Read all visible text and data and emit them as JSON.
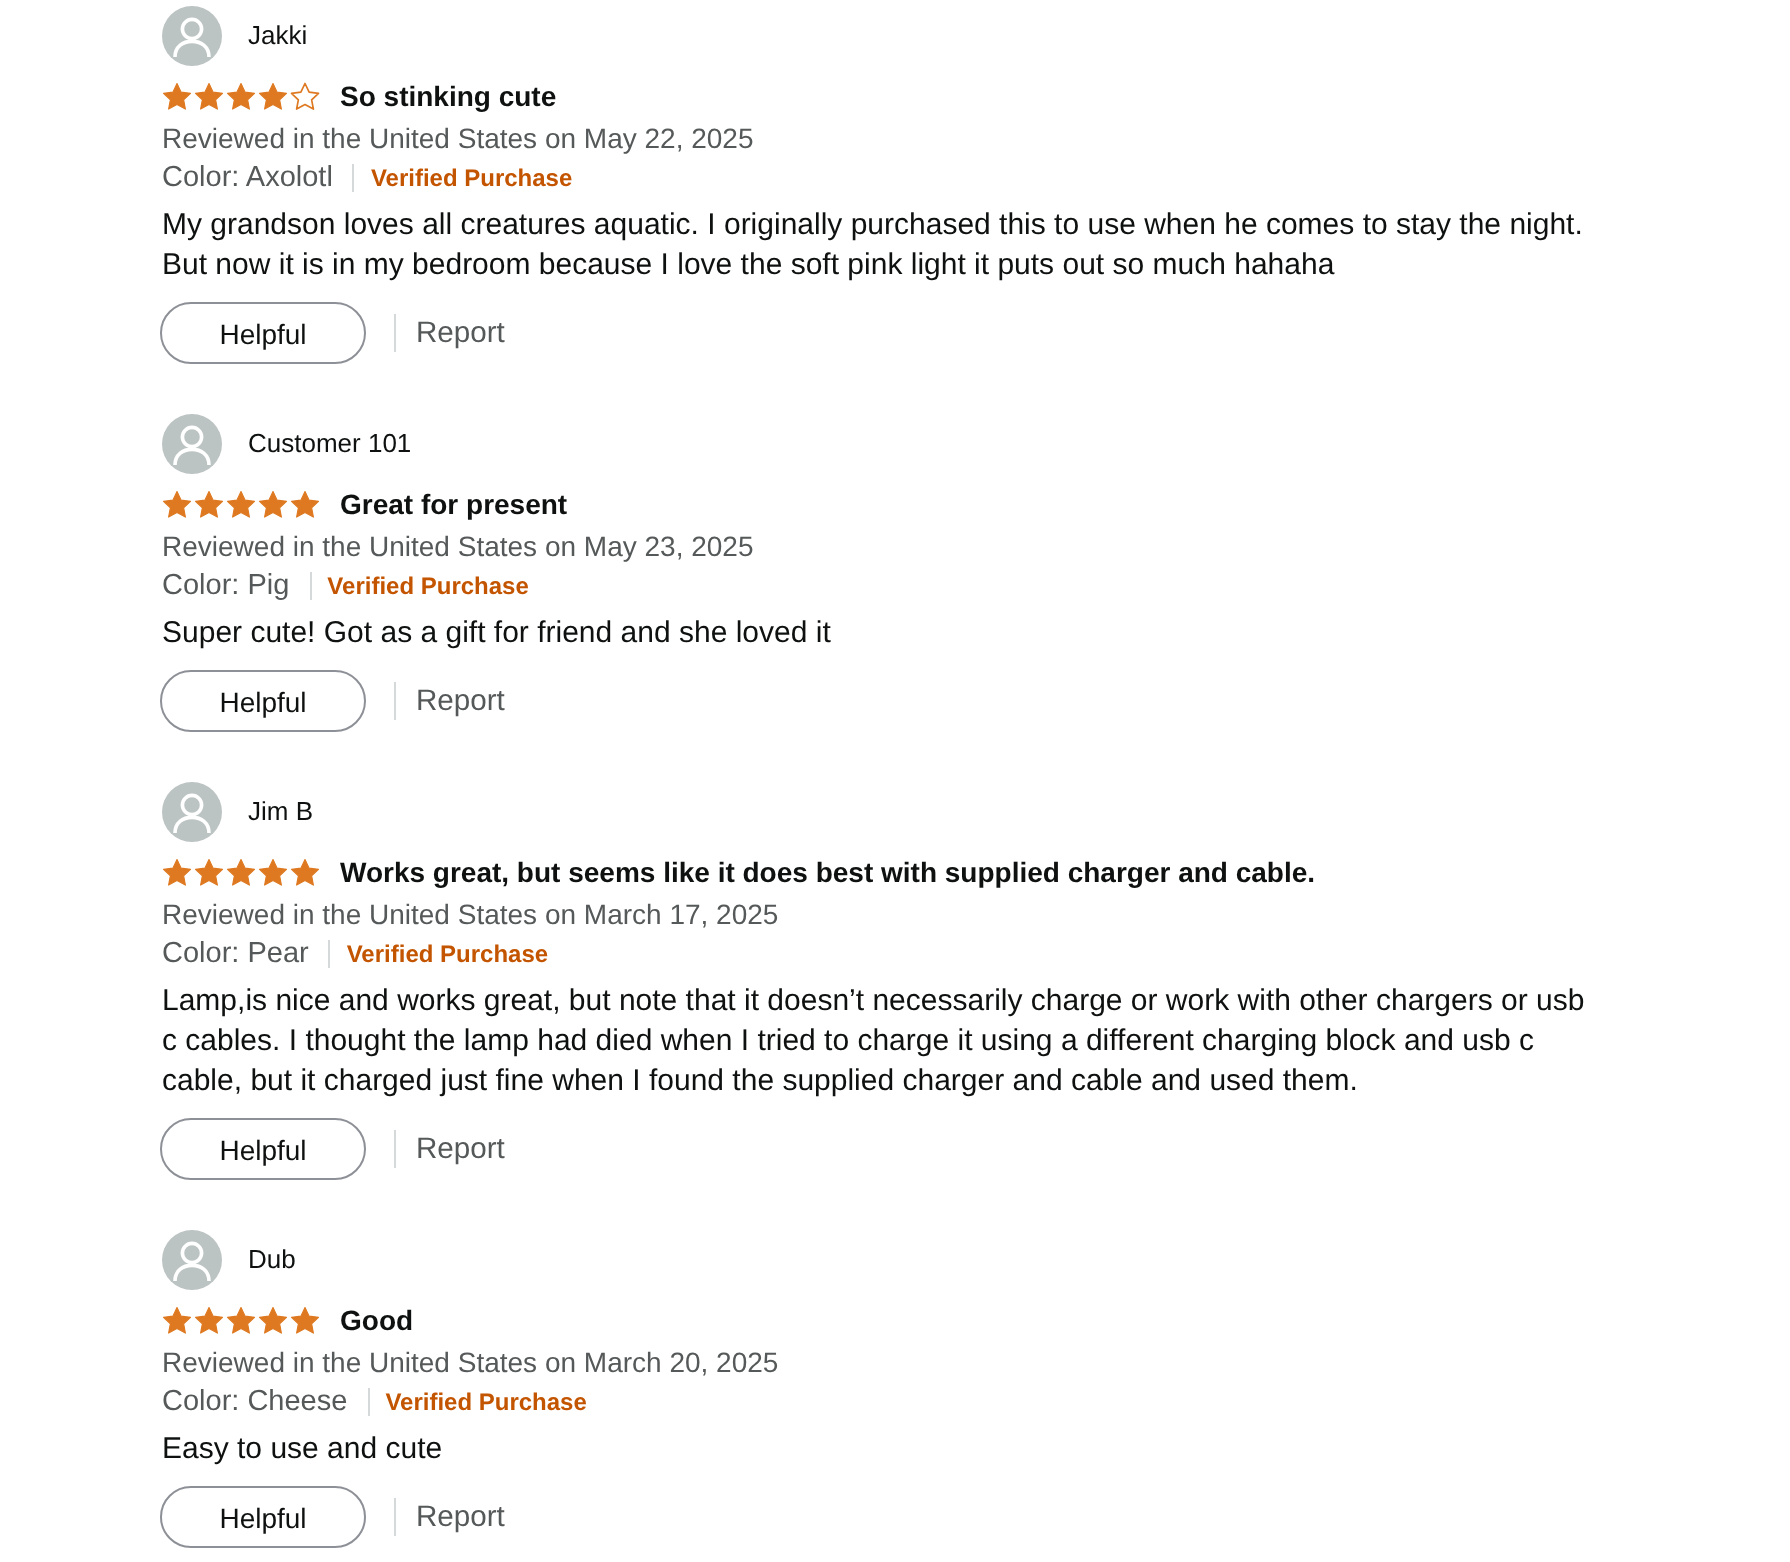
{
  "reviews": [
    {
      "reviewer": "Jakki",
      "stars": 4,
      "title": "So stinking cute",
      "date": "Reviewed in the United States on May 22, 2025",
      "variant": "Color: Axolotl",
      "badge": "Verified Purchase",
      "body": "My grandson loves all creatures aquatic. I originally purchased this to use when he comes to stay the night. But now it is in my bedroom because I love the soft pink light it puts out so much hahaha",
      "helpful": "Helpful",
      "report": "Report"
    },
    {
      "reviewer": "Customer 101",
      "stars": 5,
      "title": "Great for present",
      "date": "Reviewed in the United States on May 23, 2025",
      "variant": "Color: Pig",
      "badge": "Verified Purchase",
      "body": "Super cute! Got as a gift for friend and she loved it",
      "helpful": "Helpful",
      "report": "Report"
    },
    {
      "reviewer": "Jim B",
      "stars": 5,
      "title": "Works great, but seems like it does best with supplied charger and cable.",
      "date": "Reviewed in the United States on March 17, 2025",
      "variant": "Color: Pear",
      "badge": "Verified Purchase",
      "body": "Lamp,is nice and works great, but note that it doesn’t necessarily charge or work with other chargers or usb c cables. I thought the lamp had died when I tried to charge it using a different charging block and usb c cable, but it charged just fine when I found the supplied charger and cable and used them.",
      "helpful": "Helpful",
      "report": "Report"
    },
    {
      "reviewer": "Dub",
      "stars": 5,
      "title": "Good",
      "date": "Reviewed in the United States on March 20, 2025",
      "variant": "Color: Cheese",
      "badge": "Verified Purchase",
      "body": "Easy to use and cute",
      "helpful": "Helpful",
      "report": "Report"
    }
  ]
}
